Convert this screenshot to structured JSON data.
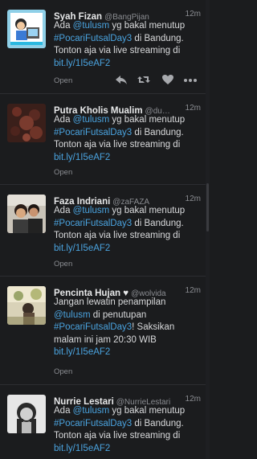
{
  "tweets": [
    {
      "name": "Syah Fizan",
      "handle": "@BangPijan",
      "time": "12m",
      "text": [
        "Ada ",
        "@tulusm",
        " yg bakal menutup ",
        "#PocariFutsalDay3",
        " di Bandung. Tonton aja via live streaming di ",
        "bit.ly/1I5eAF2"
      ],
      "open_label": "Open"
    },
    {
      "name": "Putra Kholis Mualim",
      "handle": "@du…",
      "time": "12m",
      "text": [
        "Ada ",
        "@tulusm",
        " yg bakal menutup ",
        "#PocariFutsalDay3",
        " di Bandung. Tonton aja via live streaming di ",
        "bit.ly/1I5eAF2"
      ],
      "open_label": "Open"
    },
    {
      "name": "Faza Indriani",
      "handle": "@zaFAZA",
      "time": "12m",
      "text": [
        "Ada ",
        "@tulusm",
        " yg bakal menutup ",
        "#PocariFutsalDay3",
        " di Bandung. Tonton aja via live streaming di ",
        "bit.ly/1I5eAF2"
      ],
      "open_label": "Open"
    },
    {
      "name": "Pencinta Hujan ♥",
      "handle": "@wolvida",
      "time": "12m",
      "text": [
        "Jangan lewatin penampilan ",
        "@tulusm",
        " di penutupan ",
        "#PocariFutsalDay3",
        "! Saksikan malam ini jam 20:30 WIB ",
        "bit.ly/1I5eAF2"
      ],
      "open_label": "Open"
    },
    {
      "name": "Nurrie Lestari",
      "handle": "@NurrieLestari",
      "time": "12m",
      "text": [
        "Ada ",
        "@tulusm",
        " yg bakal menutup ",
        "#PocariFutsalDay3",
        " di Bandung. Tonton aja via live streaming di ",
        "bit.ly/1I5eAF2"
      ],
      "open_label": ""
    }
  ],
  "actions": [
    "reply-icon",
    "retweet-icon",
    "favorite-icon",
    "more-icon"
  ],
  "colors": {
    "background": "#1b1c1e",
    "link": "#4aa3df",
    "name": "#e8e9ea",
    "muted": "#8b8d92"
  }
}
